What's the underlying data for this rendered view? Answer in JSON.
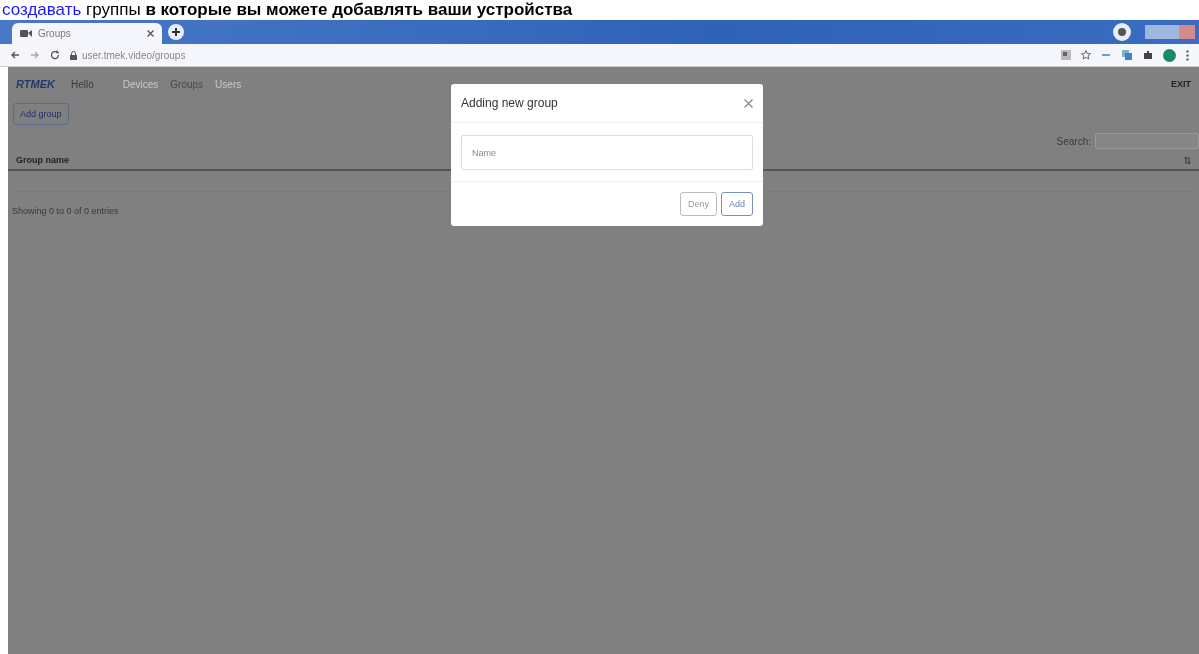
{
  "caption_parts": [
    {
      "text": "создавать",
      "kind": "link"
    },
    {
      "text": "группы",
      "kind": "plain"
    },
    {
      "text": "в которые вы можете добавлять ваши устройства",
      "kind": "bold"
    }
  ],
  "browser": {
    "tab": {
      "title": "Groups",
      "selected": true
    },
    "url": "user.tmek.video/groups"
  },
  "navbar": {
    "logo": "RTMEK",
    "greeting": "Hello",
    "links": [
      {
        "label": "Devices",
        "selected": false
      },
      {
        "label": "Groups",
        "selected": true
      },
      {
        "label": "Users",
        "selected": false
      }
    ],
    "exit": "EXIT"
  },
  "toolbar": {
    "add_button": "Add group",
    "search_label": "Search:"
  },
  "table": {
    "columns": [
      "Group name"
    ],
    "info": "Showing 0 to 0 of 0 entries"
  },
  "modal": {
    "title": "Adding new group",
    "name_field": {
      "placeholder": "Name"
    },
    "buttons": [
      {
        "label": "Deny",
        "kind": "secondary"
      },
      {
        "label": "Add",
        "kind": "primary"
      }
    ]
  }
}
